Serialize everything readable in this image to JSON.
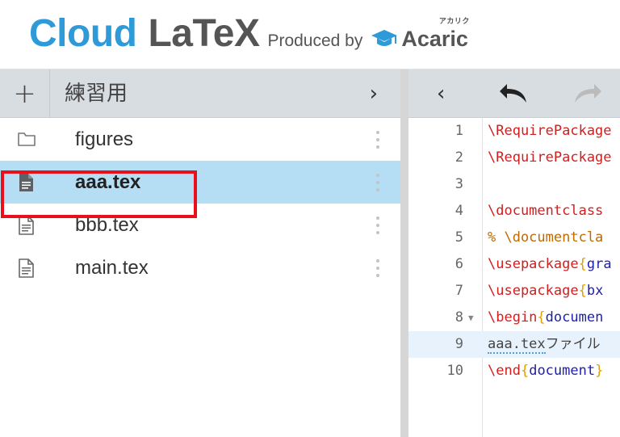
{
  "header": {
    "brand_cloud": "Cloud",
    "brand_latex": "LaTeX",
    "produced_by": "Produced by",
    "acaric_logo": {
      "name": "Acaric",
      "kana": "アカリク"
    }
  },
  "file_panel": {
    "add_label": "+",
    "project_name": "練習用",
    "collapse_label": "›",
    "files": [
      {
        "name": "figures",
        "icon": "folder-icon",
        "selected": false
      },
      {
        "name": "aaa.tex",
        "icon": "document-icon",
        "selected": true
      },
      {
        "name": "bbb.tex",
        "icon": "document-outline-icon",
        "selected": false
      },
      {
        "name": "main.tex",
        "icon": "document-outline-icon",
        "selected": false
      }
    ]
  },
  "editor": {
    "back_label": "‹",
    "undo_icon": "undo-icon",
    "redo_icon": "redo-icon",
    "active_line": 9,
    "lines": [
      {
        "no": "1",
        "fold": "",
        "tokens": [
          {
            "t": "\\RequirePackage",
            "c": "cmd"
          }
        ]
      },
      {
        "no": "2",
        "fold": "",
        "tokens": [
          {
            "t": "\\RequirePackage",
            "c": "cmd"
          }
        ]
      },
      {
        "no": "3",
        "fold": "",
        "tokens": []
      },
      {
        "no": "4",
        "fold": "",
        "tokens": [
          {
            "t": "\\documentclass",
            "c": "cmd"
          }
        ]
      },
      {
        "no": "5",
        "fold": "",
        "tokens": [
          {
            "t": "% \\documentcla",
            "c": "comment"
          }
        ]
      },
      {
        "no": "6",
        "fold": "",
        "tokens": [
          {
            "t": "\\usepackage",
            "c": "cmd"
          },
          {
            "t": "{",
            "c": "brace"
          },
          {
            "t": "gra",
            "c": "arg"
          }
        ]
      },
      {
        "no": "7",
        "fold": "",
        "tokens": [
          {
            "t": "\\usepackage",
            "c": "cmd"
          },
          {
            "t": "{",
            "c": "brace"
          },
          {
            "t": "bx",
            "c": "arg"
          }
        ]
      },
      {
        "no": "8",
        "fold": "▼",
        "tokens": [
          {
            "t": "\\begin",
            "c": "cmd"
          },
          {
            "t": "{",
            "c": "brace"
          },
          {
            "t": "documen",
            "c": "arg"
          }
        ]
      },
      {
        "no": "9",
        "fold": "",
        "tokens": [
          {
            "t": "aaa.tex",
            "c": "plain squig"
          },
          {
            "t": "ファイル",
            "c": "plain"
          }
        ]
      },
      {
        "no": "10",
        "fold": "",
        "tokens": [
          {
            "t": "\\end",
            "c": "cmd"
          },
          {
            "t": "{",
            "c": "brace"
          },
          {
            "t": "document",
            "c": "arg"
          },
          {
            "t": "}",
            "c": "brace"
          }
        ]
      }
    ]
  },
  "colors": {
    "brand_blue": "#2f9ad8",
    "toolbar_bg": "#d8dde2",
    "selected_row": "#b5def5",
    "highlight_border": "#e8101a",
    "latex_command": "#d01f1f",
    "latex_brace": "#e0a100",
    "latex_argument": "#1f1fa8",
    "latex_comment": "#c06a00"
  }
}
